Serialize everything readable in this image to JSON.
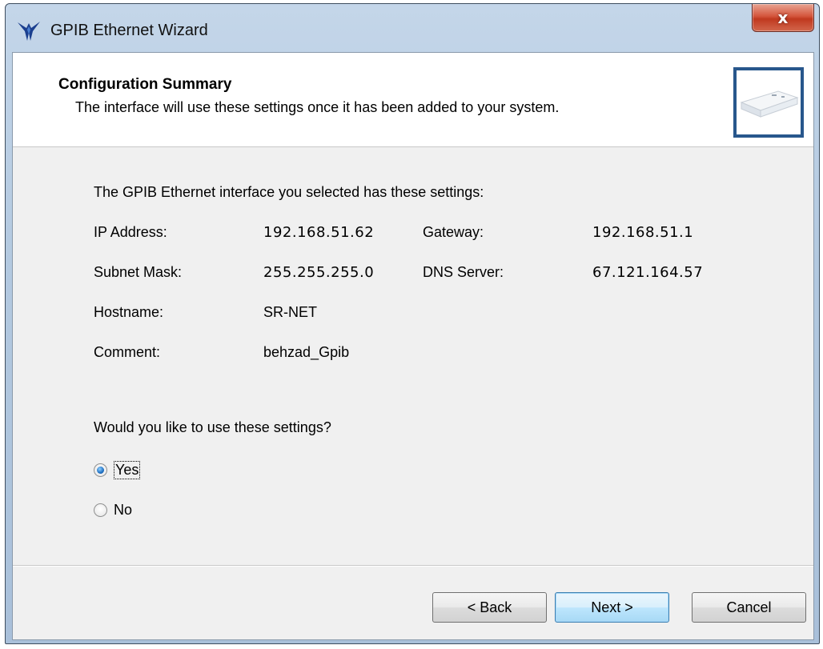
{
  "window": {
    "title": "GPIB Ethernet Wizard",
    "close_label": "x"
  },
  "header": {
    "title": "Configuration Summary",
    "subtitle": "The interface will use these settings once it has been added to your system."
  },
  "content": {
    "intro": "The GPIB Ethernet interface you selected has these settings:",
    "settings": {
      "ip_address": {
        "label": "IP Address:",
        "value": "192.168.51.62"
      },
      "gateway": {
        "label": "Gateway:",
        "value": "192.168.51.1"
      },
      "subnet_mask": {
        "label": "Subnet Mask:",
        "value": "255.255.255.0"
      },
      "dns_server": {
        "label": "DNS Server:",
        "value": "67.121.164.57"
      },
      "hostname": {
        "label": "Hostname:",
        "value": "SR-NET"
      },
      "comment": {
        "label": "Comment:",
        "value": "behzad_Gpib"
      }
    },
    "question": "Would you like to use these settings?",
    "options": {
      "yes": {
        "label": "Yes",
        "selected": true
      },
      "no": {
        "label": "No",
        "selected": false
      }
    }
  },
  "buttons": {
    "back": "< Back",
    "next": "Next >",
    "cancel": "Cancel"
  },
  "colors": {
    "header_image_border": "#28578c",
    "default_button_border": "#3c7fb1",
    "close_button": "#c0391f"
  },
  "icons": [
    "ni-eagle-logo-icon",
    "gpib-ethernet-device-icon",
    "radio-selected-icon",
    "radio-unselected-icon"
  ]
}
